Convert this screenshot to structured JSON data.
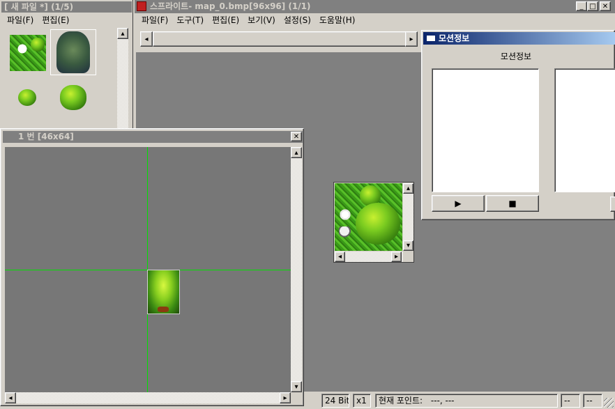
{
  "file_window": {
    "title": "[ 새 파일 *]  (1/5)",
    "menu": [
      "파일(F)",
      "편집(E)"
    ]
  },
  "main_window": {
    "title": "스프라이트- map_0.bmp[96x96]  (1/1)",
    "menu": [
      "파일(F)",
      "도구(T)",
      "편집(E)",
      "보기(V)",
      "설정(S)",
      "도움말(H)"
    ]
  },
  "motion_window": {
    "title": "모션정보",
    "header": "모션정보"
  },
  "frame_window": {
    "title": "1 번 [46x64]"
  },
  "status": {
    "bits": "24 Bit",
    "zoom": "x1",
    "point_label": "현재 포인트:",
    "point_value": "---,  ---",
    "cell_a": "--",
    "cell_b": "--"
  },
  "icons": {
    "play": "▶",
    "stop": "■",
    "close": "✕",
    "minimize": "_",
    "maximize": "□"
  },
  "colors": {
    "guide_line": "#00ff00",
    "canvas": "#808080",
    "active_title": "#0a246a"
  }
}
